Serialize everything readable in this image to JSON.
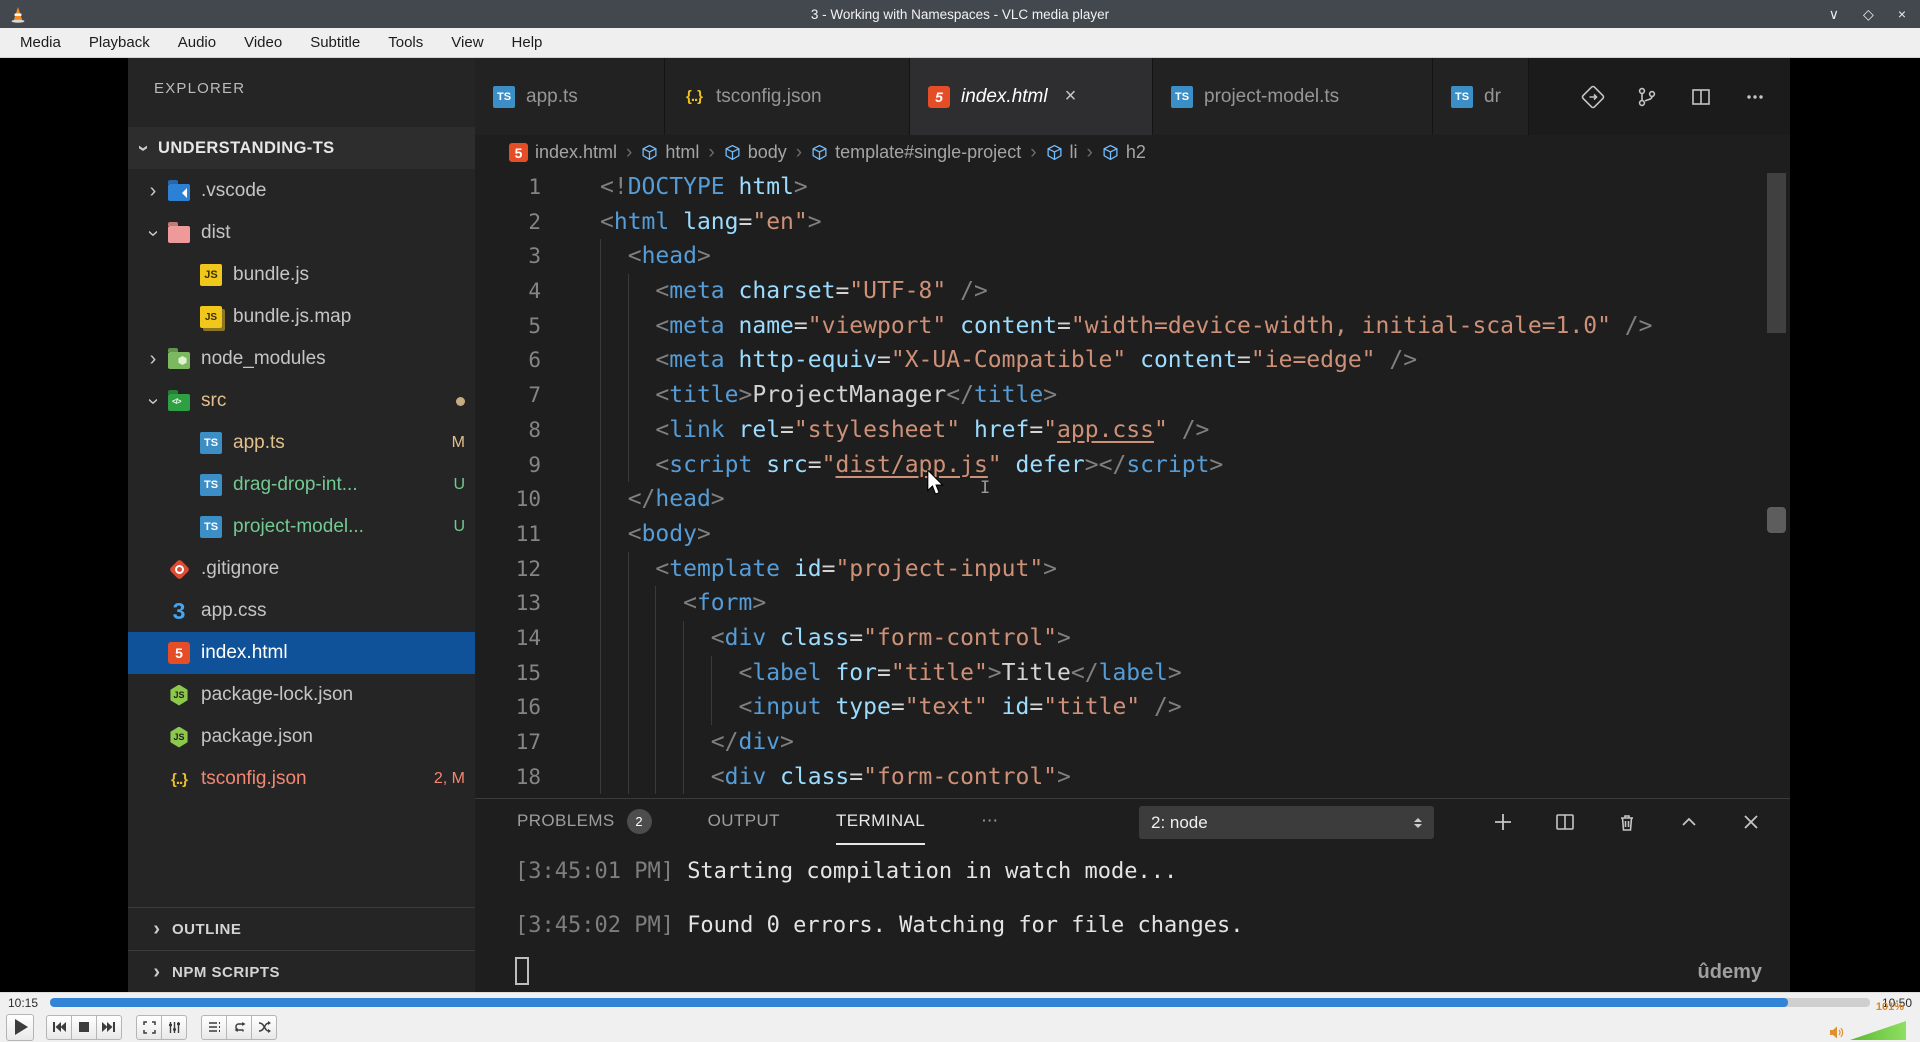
{
  "vlc": {
    "title": "3 - Working with Namespaces - VLC media player",
    "menu": [
      "Media",
      "Playback",
      "Audio",
      "Video",
      "Subtitle",
      "Tools",
      "View",
      "Help"
    ],
    "window_controls": [
      "minimize",
      "maximize",
      "close"
    ],
    "seek": {
      "elapsed": "10:15",
      "total": "10:50",
      "progress_pct": 95.5
    },
    "controls": [
      "play",
      "previous",
      "stop",
      "next",
      "fullscreen",
      "extended-settings",
      "playlist",
      "loop",
      "random"
    ],
    "volume": {
      "label": "101%",
      "level_pct": 100
    }
  },
  "vscode": {
    "explorer": {
      "header": "EXPLORER",
      "root": "UNDERSTANDING-TS",
      "items": [
        {
          "label": ".vscode",
          "icon": "folder-vscode",
          "depth": 1,
          "chevron": "collapsed"
        },
        {
          "label": "dist",
          "icon": "folder-dist",
          "depth": 1,
          "chevron": "expanded"
        },
        {
          "label": "bundle.js",
          "icon": "js",
          "depth": 2
        },
        {
          "label": "bundle.js.map",
          "icon": "jsmap",
          "depth": 2
        },
        {
          "label": "node_modules",
          "icon": "folder-node",
          "depth": 1,
          "chevron": "collapsed"
        },
        {
          "label": "src",
          "icon": "folder-src",
          "depth": 1,
          "chevron": "expanded",
          "cls": "mod",
          "dot": true
        },
        {
          "label": "app.ts",
          "icon": "ts",
          "depth": 2,
          "cls": "mod",
          "badge": "M"
        },
        {
          "label": "drag-drop-int...",
          "icon": "ts",
          "depth": 2,
          "cls": "unt",
          "badge": "U"
        },
        {
          "label": "project-model...",
          "icon": "ts",
          "depth": 2,
          "cls": "unt",
          "badge": "U"
        },
        {
          "label": ".gitignore",
          "icon": "git",
          "depth": 1
        },
        {
          "label": "app.css",
          "icon": "css",
          "depth": 1
        },
        {
          "label": "index.html",
          "icon": "html",
          "depth": 1,
          "selected": true
        },
        {
          "label": "package-lock.json",
          "icon": "node",
          "depth": 1
        },
        {
          "label": "package.json",
          "icon": "node",
          "depth": 1
        },
        {
          "label": "tsconfig.json",
          "icon": "braces",
          "depth": 1,
          "cls": "err",
          "badge": "2, M"
        }
      ],
      "sections": [
        "OUTLINE",
        "NPM SCRIPTS"
      ]
    },
    "tabs": [
      {
        "label": "app.ts",
        "icon": "ts"
      },
      {
        "label": "tsconfig.json",
        "icon": "braces"
      },
      {
        "label": "index.html",
        "icon": "html",
        "active": true,
        "close": "×"
      },
      {
        "label": "project-model.ts",
        "icon": "ts"
      },
      {
        "label": "dr",
        "icon": "ts"
      }
    ],
    "editor_actions": [
      "open-changes",
      "source-control",
      "split-editor",
      "more-actions"
    ],
    "breadcrumb": [
      {
        "label": "index.html",
        "icon": "html"
      },
      {
        "label": "html",
        "icon": "symbol"
      },
      {
        "label": "body",
        "icon": "symbol"
      },
      {
        "label": "template#single-project",
        "icon": "symbol"
      },
      {
        "label": "li",
        "icon": "symbol"
      },
      {
        "label": "h2",
        "icon": "symbol"
      }
    ],
    "code": [
      {
        "n": 1,
        "ind": 0,
        "t": [
          [
            "p",
            "<!"
          ],
          [
            "t",
            "DOCTYPE"
          ],
          [
            "o",
            " "
          ],
          [
            "a",
            "html"
          ],
          [
            "p",
            ">"
          ]
        ]
      },
      {
        "n": 2,
        "ind": 0,
        "t": [
          [
            "p",
            "<"
          ],
          [
            "t",
            "html"
          ],
          [
            "o",
            " "
          ],
          [
            "a",
            "lang"
          ],
          [
            "o",
            "="
          ],
          [
            "s",
            "\"en\""
          ],
          [
            "p",
            ">"
          ]
        ]
      },
      {
        "n": 3,
        "ind": 2,
        "t": [
          [
            "p",
            "<"
          ],
          [
            "t",
            "head"
          ],
          [
            "p",
            ">"
          ]
        ]
      },
      {
        "n": 4,
        "ind": 4,
        "t": [
          [
            "p",
            "<"
          ],
          [
            "t",
            "meta"
          ],
          [
            "o",
            " "
          ],
          [
            "a",
            "charset"
          ],
          [
            "o",
            "="
          ],
          [
            "s",
            "\"UTF-8\""
          ],
          [
            "o",
            " "
          ],
          [
            "p",
            "/>"
          ]
        ]
      },
      {
        "n": 5,
        "ind": 4,
        "t": [
          [
            "p",
            "<"
          ],
          [
            "t",
            "meta"
          ],
          [
            "o",
            " "
          ],
          [
            "a",
            "name"
          ],
          [
            "o",
            "="
          ],
          [
            "s",
            "\"viewport\""
          ],
          [
            "o",
            " "
          ],
          [
            "a",
            "content"
          ],
          [
            "o",
            "="
          ],
          [
            "s",
            "\"width=device-width, initial-scale=1.0\""
          ],
          [
            "o",
            " "
          ],
          [
            "p",
            "/>"
          ]
        ]
      },
      {
        "n": 6,
        "ind": 4,
        "t": [
          [
            "p",
            "<"
          ],
          [
            "t",
            "meta"
          ],
          [
            "o",
            " "
          ],
          [
            "a",
            "http-equiv"
          ],
          [
            "o",
            "="
          ],
          [
            "s",
            "\"X-UA-Compatible\""
          ],
          [
            "o",
            " "
          ],
          [
            "a",
            "content"
          ],
          [
            "o",
            "="
          ],
          [
            "s",
            "\"ie=edge\""
          ],
          [
            "o",
            " "
          ],
          [
            "p",
            "/>"
          ]
        ]
      },
      {
        "n": 7,
        "ind": 4,
        "t": [
          [
            "p",
            "<"
          ],
          [
            "t",
            "title"
          ],
          [
            "p",
            ">"
          ],
          [
            "o",
            "ProjectManager"
          ],
          [
            "p",
            "</"
          ],
          [
            "t",
            "title"
          ],
          [
            "p",
            ">"
          ]
        ]
      },
      {
        "n": 8,
        "ind": 4,
        "t": [
          [
            "p",
            "<"
          ],
          [
            "t",
            "link"
          ],
          [
            "o",
            " "
          ],
          [
            "a",
            "rel"
          ],
          [
            "o",
            "="
          ],
          [
            "s",
            "\"stylesheet\""
          ],
          [
            "o",
            " "
          ],
          [
            "a",
            "href"
          ],
          [
            "o",
            "="
          ],
          [
            "s",
            "\""
          ],
          [
            "u",
            "app.css"
          ],
          [
            "s",
            "\""
          ],
          [
            "o",
            " "
          ],
          [
            "p",
            "/>"
          ]
        ]
      },
      {
        "n": 9,
        "ind": 4,
        "t": [
          [
            "p",
            "<"
          ],
          [
            "t",
            "script"
          ],
          [
            "o",
            " "
          ],
          [
            "a",
            "src"
          ],
          [
            "o",
            "="
          ],
          [
            "s",
            "\""
          ],
          [
            "u",
            "dist/app.js"
          ],
          [
            "s",
            "\""
          ],
          [
            "o",
            " "
          ],
          [
            "a",
            "defer"
          ],
          [
            "p",
            ">"
          ],
          [
            "p",
            "</"
          ],
          [
            "t",
            "script"
          ],
          [
            "p",
            ">"
          ]
        ]
      },
      {
        "n": 10,
        "ind": 2,
        "t": [
          [
            "p",
            "</"
          ],
          [
            "t",
            "head"
          ],
          [
            "p",
            ">"
          ]
        ]
      },
      {
        "n": 11,
        "ind": 2,
        "t": [
          [
            "p",
            "<"
          ],
          [
            "t",
            "body"
          ],
          [
            "p",
            ">"
          ]
        ]
      },
      {
        "n": 12,
        "ind": 4,
        "t": [
          [
            "p",
            "<"
          ],
          [
            "t",
            "template"
          ],
          [
            "o",
            " "
          ],
          [
            "a",
            "id"
          ],
          [
            "o",
            "="
          ],
          [
            "s",
            "\"project-input\""
          ],
          [
            "p",
            ">"
          ]
        ]
      },
      {
        "n": 13,
        "ind": 6,
        "t": [
          [
            "p",
            "<"
          ],
          [
            "t",
            "form"
          ],
          [
            "p",
            ">"
          ]
        ]
      },
      {
        "n": 14,
        "ind": 8,
        "t": [
          [
            "p",
            "<"
          ],
          [
            "t",
            "div"
          ],
          [
            "o",
            " "
          ],
          [
            "a",
            "class"
          ],
          [
            "o",
            "="
          ],
          [
            "s",
            "\"form-control\""
          ],
          [
            "p",
            ">"
          ]
        ]
      },
      {
        "n": 15,
        "ind": 10,
        "t": [
          [
            "p",
            "<"
          ],
          [
            "t",
            "label"
          ],
          [
            "o",
            " "
          ],
          [
            "a",
            "for"
          ],
          [
            "o",
            "="
          ],
          [
            "s",
            "\"title\""
          ],
          [
            "p",
            ">"
          ],
          [
            "o",
            "Title"
          ],
          [
            "p",
            "</"
          ],
          [
            "t",
            "label"
          ],
          [
            "p",
            ">"
          ]
        ]
      },
      {
        "n": 16,
        "ind": 10,
        "t": [
          [
            "p",
            "<"
          ],
          [
            "t",
            "input"
          ],
          [
            "o",
            " "
          ],
          [
            "a",
            "type"
          ],
          [
            "o",
            "="
          ],
          [
            "s",
            "\"text\""
          ],
          [
            "o",
            " "
          ],
          [
            "a",
            "id"
          ],
          [
            "o",
            "="
          ],
          [
            "s",
            "\"title\""
          ],
          [
            "o",
            " "
          ],
          [
            "p",
            "/>"
          ]
        ]
      },
      {
        "n": 17,
        "ind": 8,
        "t": [
          [
            "p",
            "</"
          ],
          [
            "t",
            "div"
          ],
          [
            "p",
            ">"
          ]
        ]
      },
      {
        "n": 18,
        "ind": 8,
        "t": [
          [
            "p",
            "<"
          ],
          [
            "t",
            "div"
          ],
          [
            "o",
            " "
          ],
          [
            "a",
            "class"
          ],
          [
            "o",
            "="
          ],
          [
            "s",
            "\"form-control\""
          ],
          [
            "p",
            ">"
          ]
        ]
      }
    ],
    "panel": {
      "tabs": [
        {
          "label": "PROBLEMS",
          "badge": "2"
        },
        {
          "label": "OUTPUT"
        },
        {
          "label": "TERMINAL",
          "active": true
        },
        {
          "label": "⋯"
        }
      ],
      "dropdown_value": "2: node",
      "actions": [
        "new-terminal",
        "split-terminal",
        "kill-terminal",
        "maximize-panel",
        "close-panel"
      ],
      "terminal": [
        {
          "time": "[3:45:01 PM]",
          "text": "Starting compilation in watch mode..."
        },
        {
          "time": "[3:45:02 PM]",
          "text": "Found 0 errors. Watching for file changes."
        }
      ],
      "watermark": "ûdemy"
    }
  }
}
